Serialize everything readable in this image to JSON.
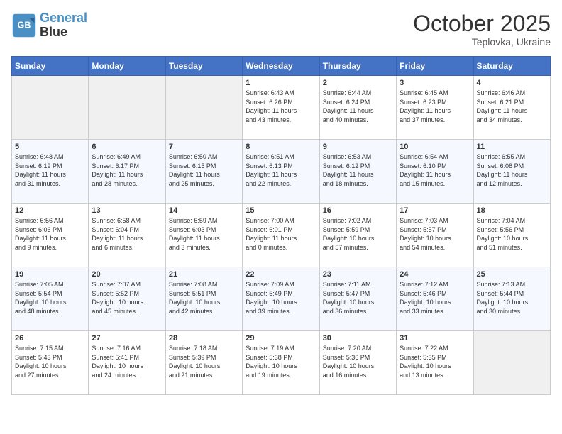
{
  "header": {
    "logo_line1": "General",
    "logo_line2": "Blue",
    "month": "October 2025",
    "location": "Teplovka, Ukraine"
  },
  "days_of_week": [
    "Sunday",
    "Monday",
    "Tuesday",
    "Wednesday",
    "Thursday",
    "Friday",
    "Saturday"
  ],
  "weeks": [
    [
      {
        "day": "",
        "info": ""
      },
      {
        "day": "",
        "info": ""
      },
      {
        "day": "",
        "info": ""
      },
      {
        "day": "1",
        "info": "Sunrise: 6:43 AM\nSunset: 6:26 PM\nDaylight: 11 hours\nand 43 minutes."
      },
      {
        "day": "2",
        "info": "Sunrise: 6:44 AM\nSunset: 6:24 PM\nDaylight: 11 hours\nand 40 minutes."
      },
      {
        "day": "3",
        "info": "Sunrise: 6:45 AM\nSunset: 6:23 PM\nDaylight: 11 hours\nand 37 minutes."
      },
      {
        "day": "4",
        "info": "Sunrise: 6:46 AM\nSunset: 6:21 PM\nDaylight: 11 hours\nand 34 minutes."
      }
    ],
    [
      {
        "day": "5",
        "info": "Sunrise: 6:48 AM\nSunset: 6:19 PM\nDaylight: 11 hours\nand 31 minutes."
      },
      {
        "day": "6",
        "info": "Sunrise: 6:49 AM\nSunset: 6:17 PM\nDaylight: 11 hours\nand 28 minutes."
      },
      {
        "day": "7",
        "info": "Sunrise: 6:50 AM\nSunset: 6:15 PM\nDaylight: 11 hours\nand 25 minutes."
      },
      {
        "day": "8",
        "info": "Sunrise: 6:51 AM\nSunset: 6:13 PM\nDaylight: 11 hours\nand 22 minutes."
      },
      {
        "day": "9",
        "info": "Sunrise: 6:53 AM\nSunset: 6:12 PM\nDaylight: 11 hours\nand 18 minutes."
      },
      {
        "day": "10",
        "info": "Sunrise: 6:54 AM\nSunset: 6:10 PM\nDaylight: 11 hours\nand 15 minutes."
      },
      {
        "day": "11",
        "info": "Sunrise: 6:55 AM\nSunset: 6:08 PM\nDaylight: 11 hours\nand 12 minutes."
      }
    ],
    [
      {
        "day": "12",
        "info": "Sunrise: 6:56 AM\nSunset: 6:06 PM\nDaylight: 11 hours\nand 9 minutes."
      },
      {
        "day": "13",
        "info": "Sunrise: 6:58 AM\nSunset: 6:04 PM\nDaylight: 11 hours\nand 6 minutes."
      },
      {
        "day": "14",
        "info": "Sunrise: 6:59 AM\nSunset: 6:03 PM\nDaylight: 11 hours\nand 3 minutes."
      },
      {
        "day": "15",
        "info": "Sunrise: 7:00 AM\nSunset: 6:01 PM\nDaylight: 11 hours\nand 0 minutes."
      },
      {
        "day": "16",
        "info": "Sunrise: 7:02 AM\nSunset: 5:59 PM\nDaylight: 10 hours\nand 57 minutes."
      },
      {
        "day": "17",
        "info": "Sunrise: 7:03 AM\nSunset: 5:57 PM\nDaylight: 10 hours\nand 54 minutes."
      },
      {
        "day": "18",
        "info": "Sunrise: 7:04 AM\nSunset: 5:56 PM\nDaylight: 10 hours\nand 51 minutes."
      }
    ],
    [
      {
        "day": "19",
        "info": "Sunrise: 7:05 AM\nSunset: 5:54 PM\nDaylight: 10 hours\nand 48 minutes."
      },
      {
        "day": "20",
        "info": "Sunrise: 7:07 AM\nSunset: 5:52 PM\nDaylight: 10 hours\nand 45 minutes."
      },
      {
        "day": "21",
        "info": "Sunrise: 7:08 AM\nSunset: 5:51 PM\nDaylight: 10 hours\nand 42 minutes."
      },
      {
        "day": "22",
        "info": "Sunrise: 7:09 AM\nSunset: 5:49 PM\nDaylight: 10 hours\nand 39 minutes."
      },
      {
        "day": "23",
        "info": "Sunrise: 7:11 AM\nSunset: 5:47 PM\nDaylight: 10 hours\nand 36 minutes."
      },
      {
        "day": "24",
        "info": "Sunrise: 7:12 AM\nSunset: 5:46 PM\nDaylight: 10 hours\nand 33 minutes."
      },
      {
        "day": "25",
        "info": "Sunrise: 7:13 AM\nSunset: 5:44 PM\nDaylight: 10 hours\nand 30 minutes."
      }
    ],
    [
      {
        "day": "26",
        "info": "Sunrise: 7:15 AM\nSunset: 5:43 PM\nDaylight: 10 hours\nand 27 minutes."
      },
      {
        "day": "27",
        "info": "Sunrise: 7:16 AM\nSunset: 5:41 PM\nDaylight: 10 hours\nand 24 minutes."
      },
      {
        "day": "28",
        "info": "Sunrise: 7:18 AM\nSunset: 5:39 PM\nDaylight: 10 hours\nand 21 minutes."
      },
      {
        "day": "29",
        "info": "Sunrise: 7:19 AM\nSunset: 5:38 PM\nDaylight: 10 hours\nand 19 minutes."
      },
      {
        "day": "30",
        "info": "Sunrise: 7:20 AM\nSunset: 5:36 PM\nDaylight: 10 hours\nand 16 minutes."
      },
      {
        "day": "31",
        "info": "Sunrise: 7:22 AM\nSunset: 5:35 PM\nDaylight: 10 hours\nand 13 minutes."
      },
      {
        "day": "",
        "info": ""
      }
    ]
  ]
}
